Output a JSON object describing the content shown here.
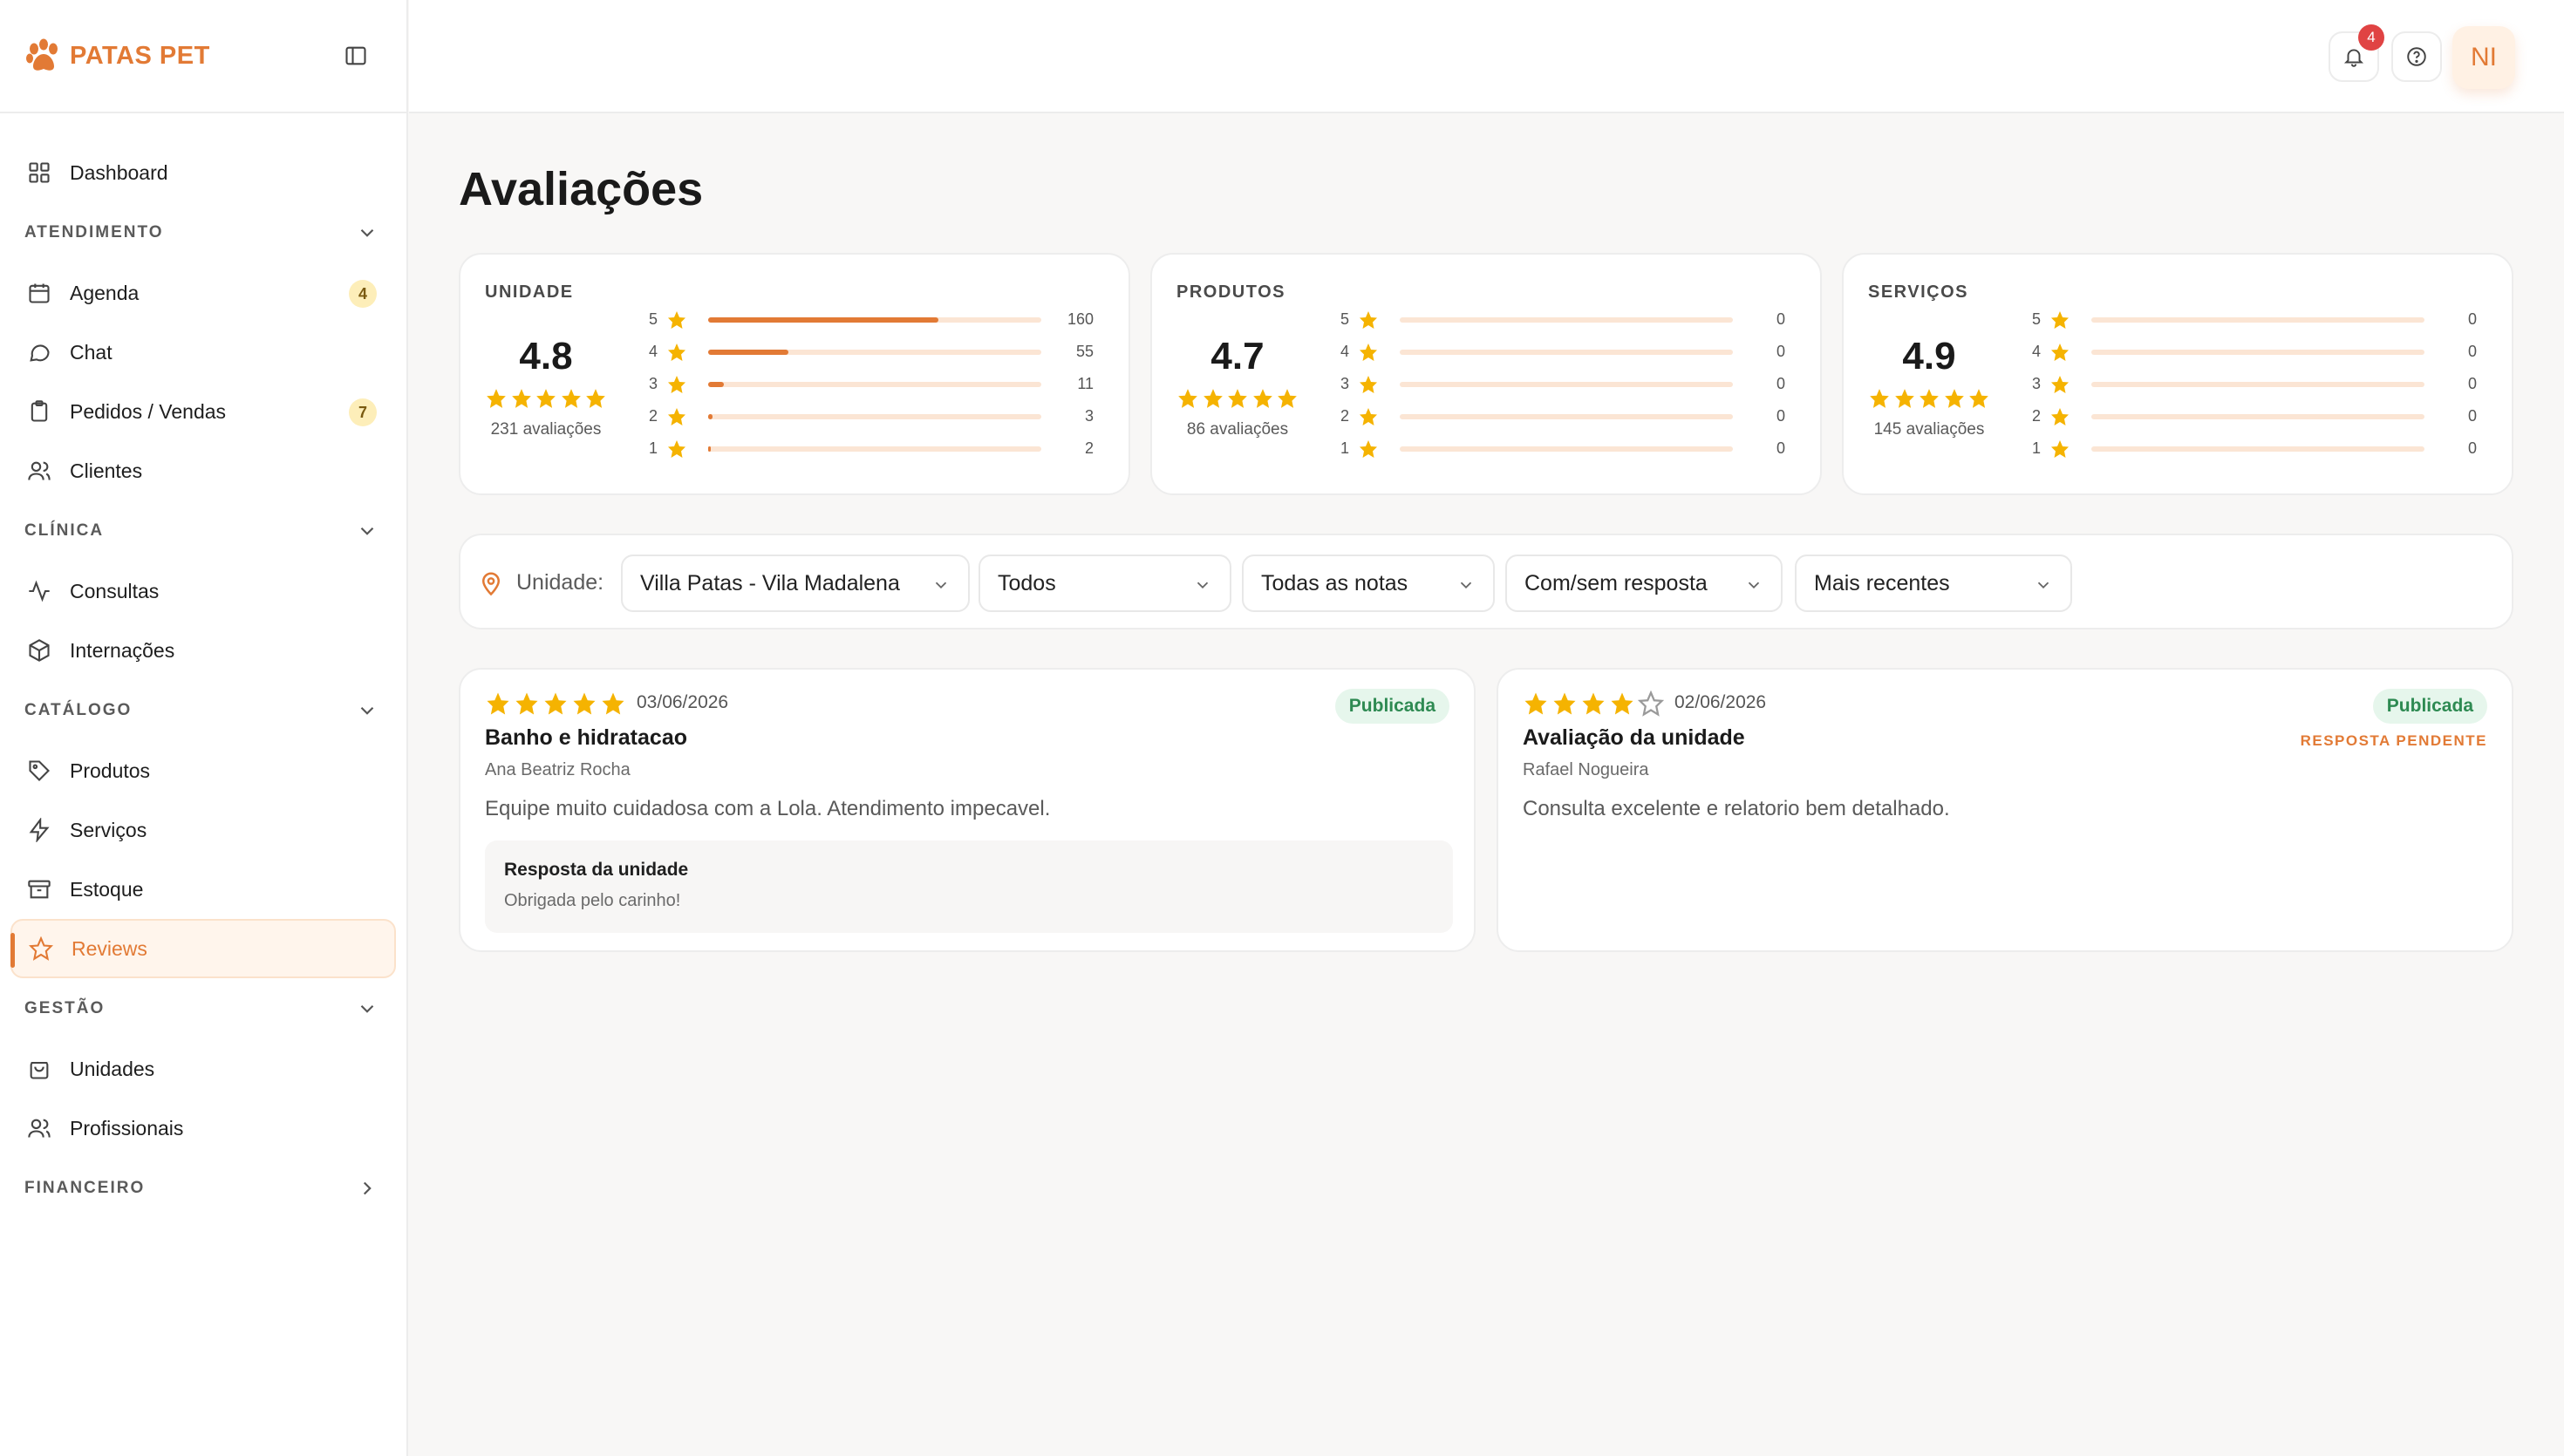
{
  "brand": {
    "name": "PATAS PET"
  },
  "sidebar": {
    "dashboard": "Dashboard",
    "sections": {
      "atendimento": "ATENDIMENTO",
      "clinica": "CLÍNICA",
      "catalogo": "CATÁLOGO",
      "gestao": "GESTÃO",
      "financeiro": "FINANCEIRO"
    },
    "items": {
      "agenda": {
        "label": "Agenda",
        "badge": "4"
      },
      "chat": {
        "label": "Chat"
      },
      "pedidos": {
        "label": "Pedidos / Vendas",
        "badge": "7"
      },
      "clientes": {
        "label": "Clientes"
      },
      "consultas": {
        "label": "Consultas"
      },
      "internacoes": {
        "label": "Internações"
      },
      "produtos": {
        "label": "Produtos"
      },
      "servicos": {
        "label": "Serviços"
      },
      "estoque": {
        "label": "Estoque"
      },
      "reviews": {
        "label": "Reviews"
      },
      "unidades": {
        "label": "Unidades"
      },
      "profissionais": {
        "label": "Profissionais"
      }
    }
  },
  "topbar": {
    "notification_count": "4",
    "avatar_initials": "NI"
  },
  "page": {
    "title": "Avaliações"
  },
  "summary_cards": [
    {
      "label": "UNIDADE",
      "average": "4.8",
      "count": "231 avaliações",
      "rows": [
        {
          "level": "5",
          "value": "160",
          "ratio": 0.69
        },
        {
          "level": "4",
          "value": "55",
          "ratio": 0.24
        },
        {
          "level": "3",
          "value": "11",
          "ratio": 0.048
        },
        {
          "level": "2",
          "value": "3",
          "ratio": 0.013
        },
        {
          "level": "1",
          "value": "2",
          "ratio": 0.009
        }
      ]
    },
    {
      "label": "PRODUTOS",
      "average": "4.7",
      "count": "86 avaliações",
      "rows": [
        {
          "level": "5",
          "value": "0",
          "ratio": 0
        },
        {
          "level": "4",
          "value": "0",
          "ratio": 0
        },
        {
          "level": "3",
          "value": "0",
          "ratio": 0
        },
        {
          "level": "2",
          "value": "0",
          "ratio": 0
        },
        {
          "level": "1",
          "value": "0",
          "ratio": 0
        }
      ]
    },
    {
      "label": "SERVIÇOS",
      "average": "4.9",
      "count": "145 avaliações",
      "rows": [
        {
          "level": "5",
          "value": "0",
          "ratio": 0
        },
        {
          "level": "4",
          "value": "0",
          "ratio": 0
        },
        {
          "level": "3",
          "value": "0",
          "ratio": 0
        },
        {
          "level": "2",
          "value": "0",
          "ratio": 0
        },
        {
          "level": "1",
          "value": "0",
          "ratio": 0
        }
      ]
    }
  ],
  "filters": {
    "unit_label": "Unidade:",
    "unit": "Villa Patas - Vila Madalena",
    "type": "Todos",
    "rating": "Todas as notas",
    "response": "Com/sem resposta",
    "sort": "Mais recentes"
  },
  "reviews": [
    {
      "rating": 5,
      "date": "03/06/2026",
      "title": "Banho e hidratacao",
      "author": "Ana Beatriz Rocha",
      "text": "Equipe muito cuidadosa com a Lola. Atendimento impecavel.",
      "status": "Publicada",
      "reply_title": "Resposta da unidade",
      "reply_text": "Obrigada pelo carinho!"
    },
    {
      "rating": 4,
      "date": "02/06/2026",
      "title": "Avaliação da unidade",
      "author": "Rafael Nogueira",
      "text": "Consulta excelente e relatorio bem detalhado.",
      "status": "Publicada",
      "pending_label": "RESPOSTA PENDENTE"
    }
  ],
  "colors": {
    "accent": "#e27a35",
    "star": "#f5b301",
    "star_empty": "#9a9a9a",
    "published_bg": "#e6f6ec",
    "published_text": "#2e8a52"
  }
}
